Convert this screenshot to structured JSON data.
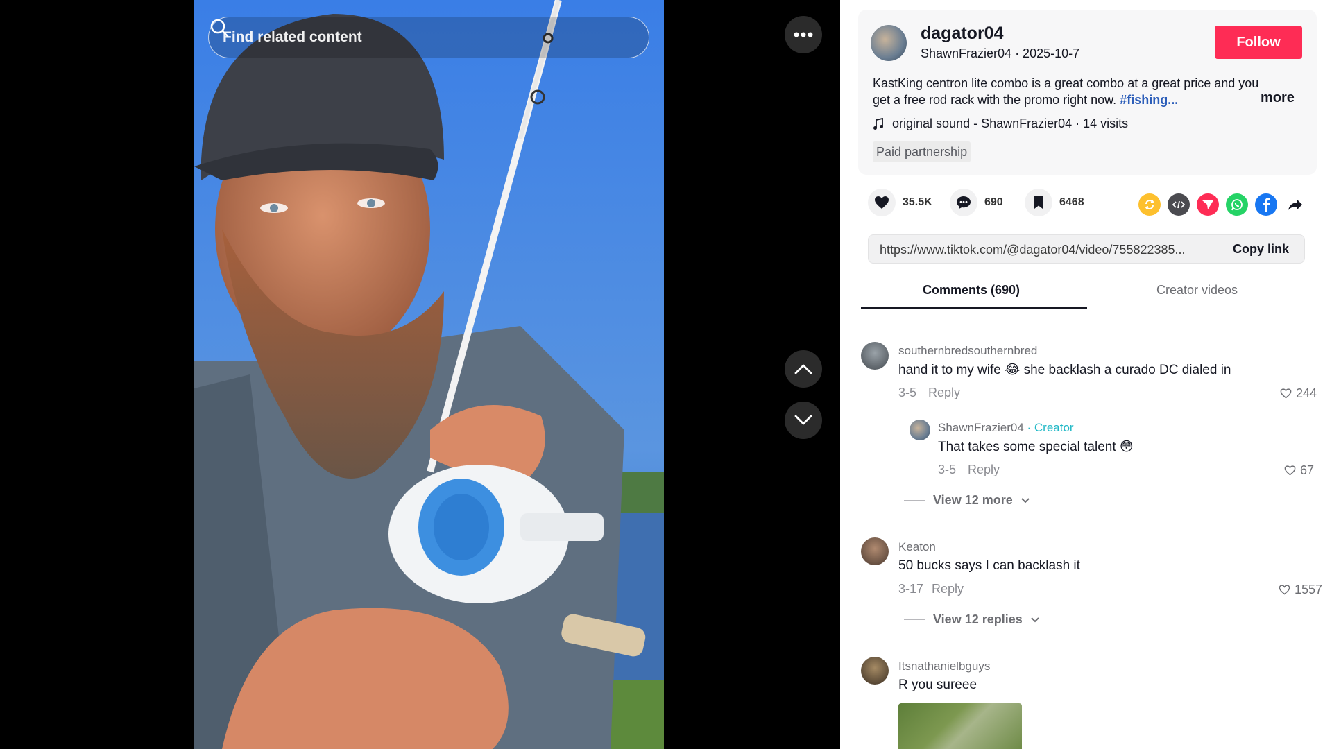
{
  "video": {
    "search_placeholder": "Find related content",
    "more_icon": "ellipsis-icon",
    "up_icon": "chevron-up-icon",
    "down_icon": "chevron-down-icon"
  },
  "author": {
    "username": "dagator04",
    "subtitle": "ShawnFrazier04 · 2025-10-7",
    "follow_label": "Follow"
  },
  "description": {
    "text": "KastKing centron lite combo is a great combo at a great price and you get a free rod rack with the promo right now.",
    "hashtag": "#fishing...",
    "more_label": "more"
  },
  "music": {
    "icon": "music-note-icon",
    "text": "original sound - ShawnFrazier04 · 14 visits"
  },
  "paid_label": "Paid partnership",
  "actions": {
    "likes": "35.5K",
    "comments": "690",
    "saves": "6468"
  },
  "share_icons": [
    "repost-icon",
    "embed-icon",
    "send-icon",
    "whatsapp-icon",
    "facebook-icon",
    "share-arrow-icon"
  ],
  "link": {
    "url": "https://www.tiktok.com/@dagator04/video/755822385...",
    "copy_label": "Copy link"
  },
  "tabs": {
    "comments": "Comments (690)",
    "creator_videos": "Creator videos"
  },
  "comments": [
    {
      "user": "southernbredsouthernbred",
      "text": "hand it to my wife 😂 she backlash a curado DC dialed in",
      "date": "3-5",
      "reply": "Reply",
      "likes": "244"
    },
    {
      "user": "ShawnFrazier04",
      "creator_tag": "· Creator",
      "text": "That takes some special talent 😳",
      "date": "3-5",
      "reply": "Reply",
      "likes": "67"
    },
    {
      "user": "Keaton",
      "text": "50 bucks says I can backlash it",
      "date": "3-17",
      "reply": "Reply",
      "likes": "1557"
    },
    {
      "user": "Itsnathanielbguys",
      "text": "R you sureee"
    }
  ],
  "view_more_1": "View 12 more",
  "view_more_2": "View 12 replies",
  "colors": {
    "accent": "#fe2c55",
    "hashtag": "#2b5db9",
    "creator": "#20b8c6"
  }
}
